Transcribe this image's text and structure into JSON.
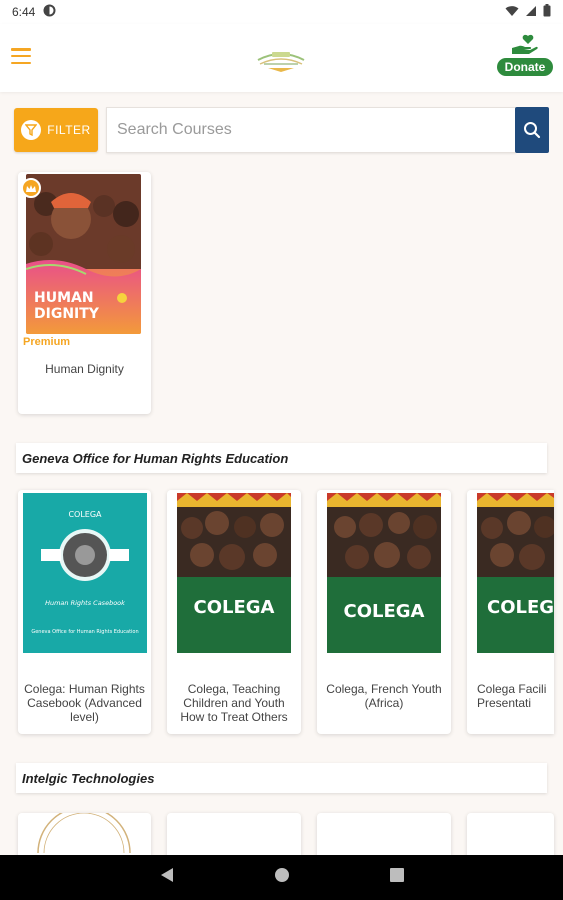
{
  "status_bar": {
    "time": "6:44"
  },
  "header": {
    "donate_label": "Donate"
  },
  "filter": {
    "label": "FILTER"
  },
  "search": {
    "placeholder": "Search Courses"
  },
  "featured": {
    "badge": "Premium",
    "title": "Human Dignity",
    "cover_title": "HUMAN DIGNITY"
  },
  "sections": [
    {
      "title": "Geneva Office for Human Rights Education",
      "courses": [
        {
          "title": "Colega: Human Rights Casebook (Advanced level)",
          "cover_brand": "COLEGA",
          "cover_subtitle": "Human Rights Casebook",
          "cover_footer": "Geneva Office for Human Rights Education"
        },
        {
          "title": "Colega, Teaching Children and Youth How to Treat Others",
          "cover_brand": "COLEGA"
        },
        {
          "title": "Colega, French Youth (Africa)",
          "cover_brand": "COLEGA"
        },
        {
          "title": "Colega Facili Presentati",
          "cover_brand": "COLEG"
        }
      ]
    },
    {
      "title": "Intelgic Technologies"
    }
  ],
  "colors": {
    "accent": "#f5a623",
    "donate": "#2e8b3d",
    "search_button": "#1f4a7c",
    "teal_cover": "#18a9a7",
    "green_cover": "#1f6e3a"
  }
}
